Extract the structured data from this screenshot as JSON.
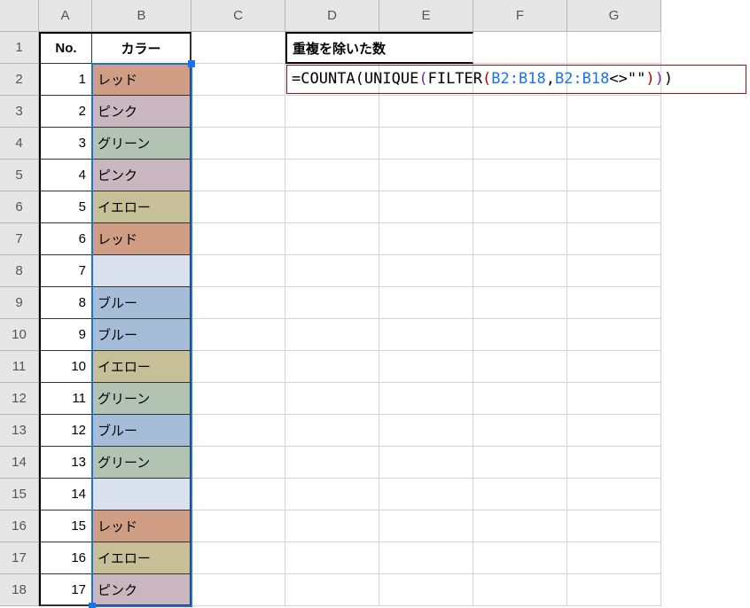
{
  "columns": [
    "A",
    "B",
    "C",
    "D",
    "E",
    "F",
    "G"
  ],
  "rows": [
    1,
    2,
    3,
    4,
    5,
    6,
    7,
    8,
    9,
    10,
    11,
    12,
    13,
    14,
    15,
    16,
    17,
    18
  ],
  "headers": {
    "A1": "No.",
    "B1": "カラー",
    "D1": "重複を除いた数"
  },
  "colA": [
    "1",
    "2",
    "3",
    "4",
    "5",
    "6",
    "7",
    "8",
    "9",
    "10",
    "11",
    "12",
    "13",
    "14",
    "15",
    "16",
    "17"
  ],
  "colB": [
    {
      "v": "レッド",
      "bg": "#cf9c84"
    },
    {
      "v": "ピンク",
      "bg": "#cab6be"
    },
    {
      "v": "グリーン",
      "bg": "#b2c3b3"
    },
    {
      "v": "ピンク",
      "bg": "#cab6be"
    },
    {
      "v": "イエロー",
      "bg": "#c6bf98"
    },
    {
      "v": "レッド",
      "bg": "#cf9c84"
    },
    {
      "v": "",
      "bg": "#d8e1ed"
    },
    {
      "v": "ブルー",
      "bg": "#a6bdd8"
    },
    {
      "v": "ブルー",
      "bg": "#a6bdd8"
    },
    {
      "v": "イエロー",
      "bg": "#c6bf98"
    },
    {
      "v": "グリーン",
      "bg": "#b2c3b3"
    },
    {
      "v": "ブルー",
      "bg": "#a6bdd8"
    },
    {
      "v": "グリーン",
      "bg": "#b2c3b3"
    },
    {
      "v": "",
      "bg": "#d8e1ed"
    },
    {
      "v": "レッド",
      "bg": "#cf9c84"
    },
    {
      "v": "イエロー",
      "bg": "#c6bf98"
    },
    {
      "v": "ピンク",
      "bg": "#cab6be"
    }
  ],
  "formula": {
    "eq": "=",
    "fn1": "COUNTA",
    "fn2": "UNIQUE",
    "fn3": "FILTER",
    "ref1": "B2:B18",
    "comma": ",",
    "ref2": "B2:B18",
    "op": "<>",
    "str": "\"\"",
    "close1": ")",
    "close2": ")",
    "close3": ")"
  },
  "chart_data": null
}
